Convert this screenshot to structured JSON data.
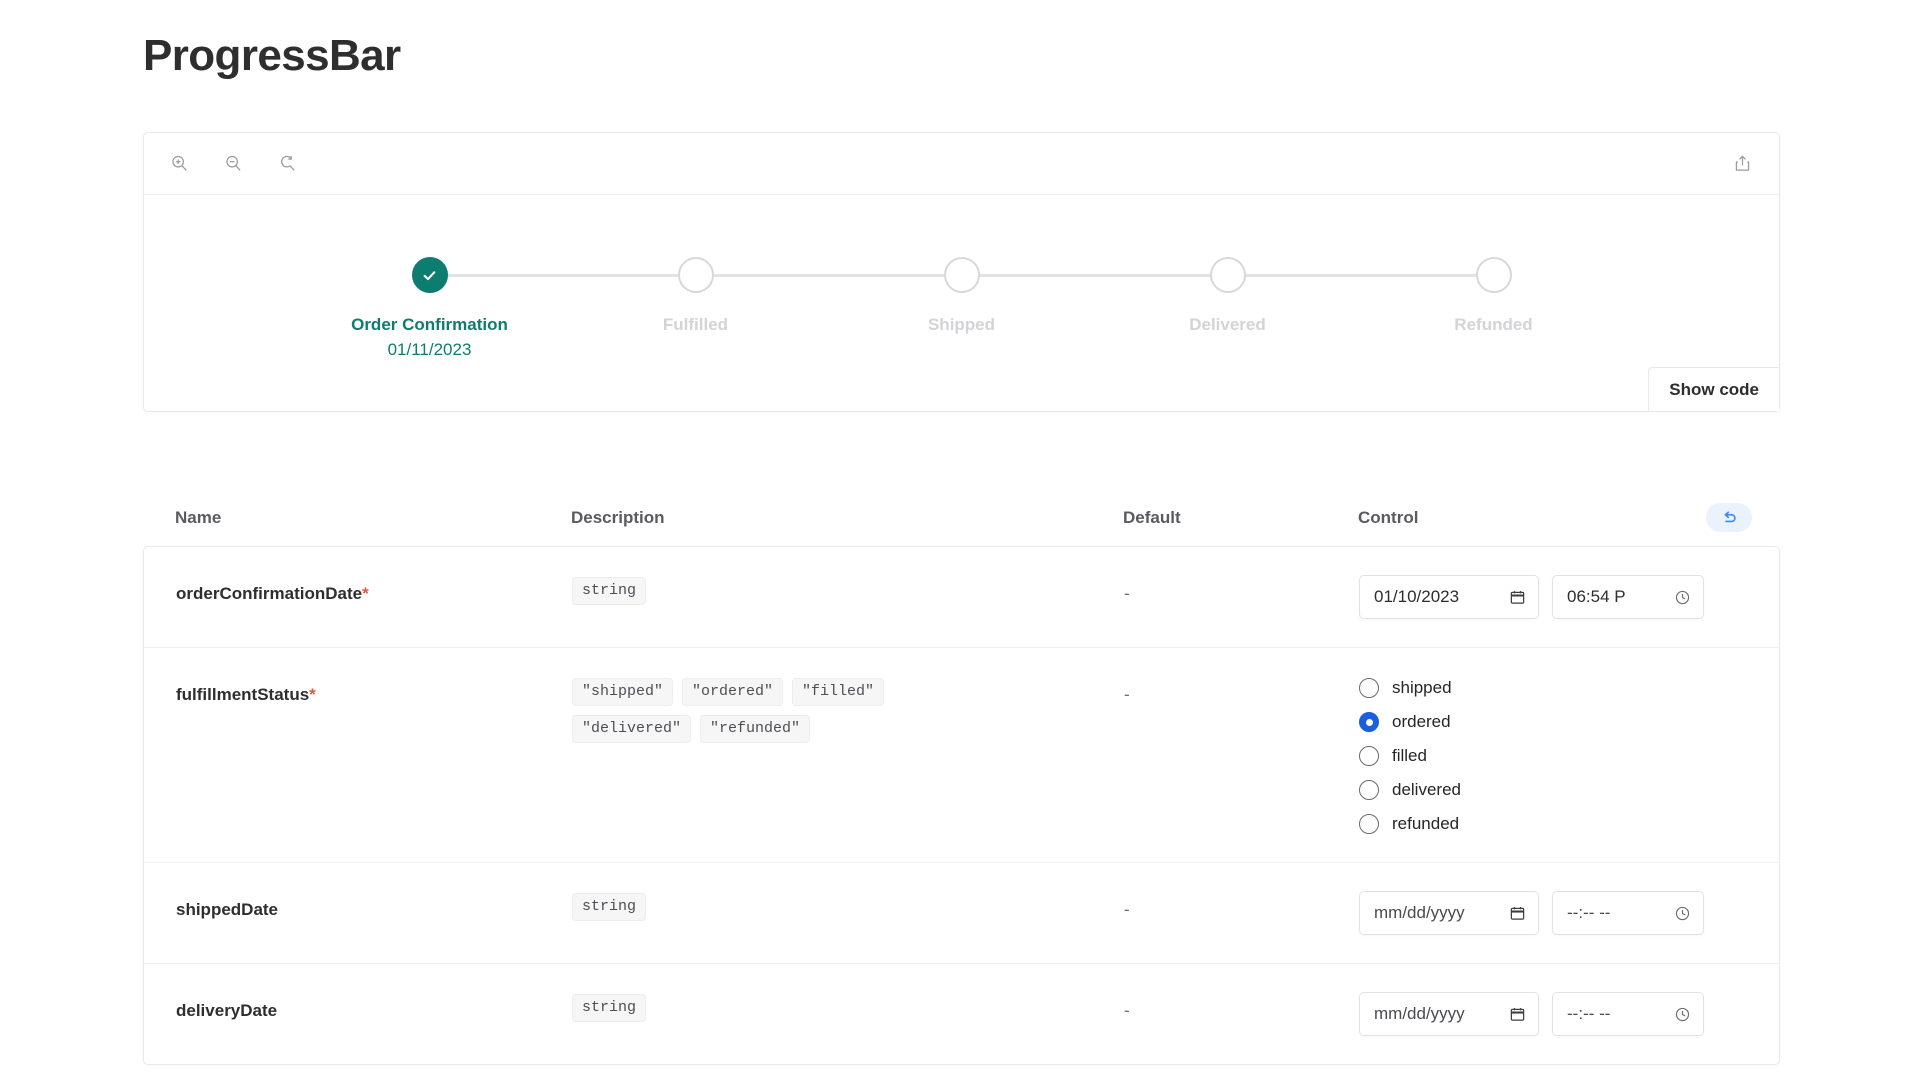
{
  "page": {
    "title": "ProgressBar"
  },
  "toolbar": {
    "zoom_in": "zoom-in",
    "zoom_out": "zoom-out",
    "zoom_reset": "zoom-reset",
    "share": "share"
  },
  "preview": {
    "show_code_label": "Show code",
    "steps": [
      {
        "label": "Order Confirmation",
        "date": "01/11/2023",
        "state": "done"
      },
      {
        "label": "Fulfilled",
        "date": "",
        "state": "pending"
      },
      {
        "label": "Shipped",
        "date": "",
        "state": "pending"
      },
      {
        "label": "Delivered",
        "date": "",
        "state": "pending"
      },
      {
        "label": "Refunded",
        "date": "",
        "state": "pending"
      }
    ]
  },
  "args_table": {
    "headers": {
      "name": "Name",
      "description": "Description",
      "default": "Default",
      "control": "Control"
    },
    "reset_label": "reset controls",
    "rows": [
      {
        "name": "orderConfirmationDate",
        "required": true,
        "required_mark": "*",
        "types": [
          "string"
        ],
        "default": "-",
        "control": {
          "kind": "datetime",
          "date_value": "01/10/2023",
          "date_placeholder": "mm/dd/yyyy",
          "time_value": "06:54 P",
          "time_placeholder": "--:-- --"
        }
      },
      {
        "name": "fulfillmentStatus",
        "required": true,
        "required_mark": "*",
        "types": [
          "\"shipped\"",
          "\"ordered\"",
          "\"filled\"",
          "\"delivered\"",
          "\"refunded\""
        ],
        "default": "-",
        "control": {
          "kind": "radio",
          "options": [
            "shipped",
            "ordered",
            "filled",
            "delivered",
            "refunded"
          ],
          "selected": "ordered"
        }
      },
      {
        "name": "shippedDate",
        "required": false,
        "required_mark": "",
        "types": [
          "string"
        ],
        "default": "-",
        "control": {
          "kind": "datetime",
          "date_value": "",
          "date_placeholder": "mm/dd/yyyy",
          "time_value": "",
          "time_placeholder": "--:-- --"
        }
      },
      {
        "name": "deliveryDate",
        "required": false,
        "required_mark": "",
        "types": [
          "string"
        ],
        "default": "-",
        "control": {
          "kind": "datetime",
          "date_value": "",
          "date_placeholder": "mm/dd/yyyy",
          "time_value": "",
          "time_placeholder": "--:-- --"
        }
      }
    ]
  },
  "colors": {
    "accent_teal": "#0d7d70",
    "accent_blue": "#1a5fe0",
    "required_red": "#e0583a",
    "muted_gray": "#d3d3d8"
  }
}
